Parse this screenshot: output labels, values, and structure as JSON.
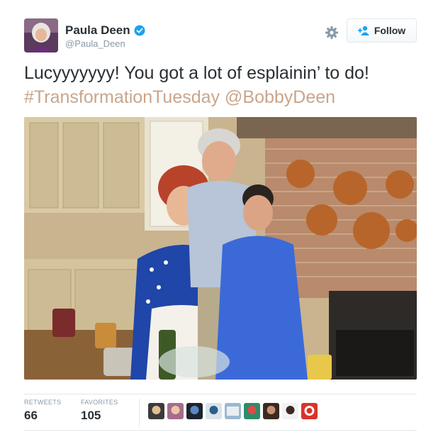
{
  "author": {
    "name": "Paula Deen",
    "handle": "@Paula_Deen",
    "verified": true,
    "avatar_icon": "user-avatar-photo"
  },
  "actions": {
    "follow_label": "Follow",
    "settings_icon": "gear-icon",
    "follow_icon": "add-user-icon"
  },
  "tweet": {
    "line1": "Lucyyyyyyy! You got a lot of esplainin’ to do!",
    "hashtag": "#TransformationTuesday",
    "mention": "@BobbyDeen"
  },
  "stats": {
    "retweets_label": "RETWEETS",
    "retweets_count": "66",
    "favorites_label": "FAVORITES",
    "favorites_count": "105"
  },
  "favoriter_avatars": [
    "face-1",
    "face-2",
    "face-3",
    "face-4",
    "face-5",
    "face-6",
    "face-7",
    "face-8",
    "face-9"
  ],
  "colors": {
    "link": "#c9a58c",
    "text": "#292f33",
    "muted": "#8899a6",
    "verified": "#1da1f2"
  }
}
